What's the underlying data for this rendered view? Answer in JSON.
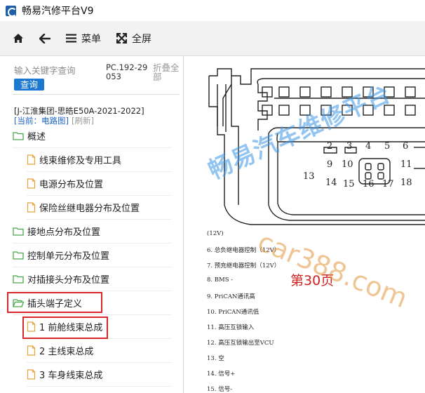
{
  "window": {
    "title": "畅易汽修平台V9"
  },
  "toolbar": {
    "menu_label": "菜单",
    "fullscreen_label": "全屏"
  },
  "sidebar": {
    "search_placeholder": "输入关键字查询",
    "search_button": "查询",
    "pc_code": "PC.192-29053",
    "collapse_all": "折叠全部",
    "vehicle_title": "[J-江淮集团-思皓E50A-2021-2022]",
    "current_label": "[当前：电路图]",
    "refresh_label": "[刷新]",
    "tree": [
      {
        "label": "概述",
        "type": "folder"
      },
      {
        "label": "线束维修及专用工具",
        "type": "file"
      },
      {
        "label": "电源分布及位置",
        "type": "file"
      },
      {
        "label": "保险丝继电器分布及位置",
        "type": "file"
      },
      {
        "label": "接地点分布及位置",
        "type": "folder"
      },
      {
        "label": "控制单元分布及位置",
        "type": "folder"
      },
      {
        "label": "对插接头分布及位置",
        "type": "folder"
      },
      {
        "label": "插头端子定义",
        "type": "folder-open",
        "highlighted": true
      },
      {
        "label": "1 前舱线束总成",
        "type": "file",
        "highlighted": true
      },
      {
        "label": "2 主线束总成",
        "type": "file"
      },
      {
        "label": "3 车身线束总成",
        "type": "file"
      }
    ]
  },
  "document": {
    "connector_pins": [
      "2",
      "3",
      "4",
      "5",
      "6",
      "9",
      "10",
      "11",
      "13",
      "14",
      "15",
      "16",
      "17",
      "18"
    ],
    "pin_list": [
      "(12V)",
      "6. 总负继电器控制（12V）",
      "7. 预充继电器控制（12V）",
      "8. BMS -",
      "9. PriCAN通讯高",
      "10. PriCAN通讯低",
      "11. 高压互锁输入",
      "12. 高压互锁输出至VCU",
      "13. 空",
      "14. 信号+",
      "15. 信号-"
    ],
    "page_label": "第30页",
    "watermark_cn": "畅易汽车维修平台",
    "watermark_url": "car388.com"
  },
  "colors": {
    "accent": "#1c78d0",
    "highlight": "#d9272e",
    "page_label": "#d31f1f",
    "folder": "#4aa84a",
    "file": "#e8a23a"
  }
}
